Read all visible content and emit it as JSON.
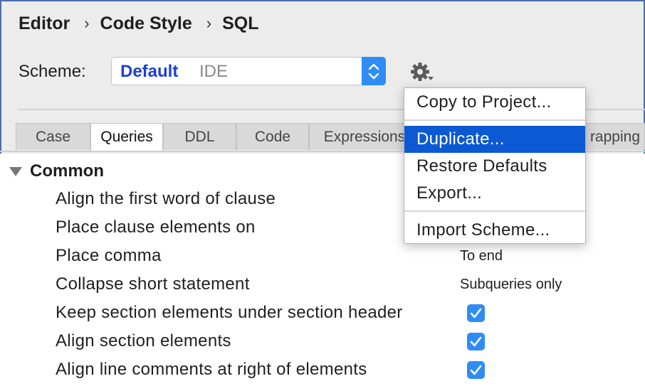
{
  "breadcrumb": {
    "items": [
      "Editor",
      "Code Style",
      "SQL"
    ],
    "separator": "›"
  },
  "scheme": {
    "label": "Scheme:",
    "name": "Default",
    "type": "IDE"
  },
  "gear_icon": "gear-icon",
  "tabs": [
    "Case",
    "Queries",
    "DDL",
    "Code",
    "Expressions",
    "rapping"
  ],
  "active_tab": "Queries",
  "section": {
    "title": "Common"
  },
  "rows": [
    {
      "label": "Align the first word of clause",
      "value": ""
    },
    {
      "label": "Place clause elements on",
      "value": ""
    },
    {
      "label": "Place comma",
      "value": "To end"
    },
    {
      "label": "Collapse short statement",
      "value": "Subqueries only"
    },
    {
      "label": "Keep section elements under section header",
      "checked": true
    },
    {
      "label": "Align section elements",
      "checked": true
    },
    {
      "label": "Align line comments at right of elements",
      "checked": true
    }
  ],
  "menu": {
    "items": [
      "Copy to Project...",
      "Duplicate...",
      "Restore Defaults",
      "Export...",
      "Import Scheme..."
    ],
    "highlighted": "Duplicate..."
  },
  "colors": {
    "accent": "#2f8cf4",
    "highlight": "#0c59d4",
    "scheme_name": "#1c3fd6",
    "frame": "#4a6fa8"
  }
}
